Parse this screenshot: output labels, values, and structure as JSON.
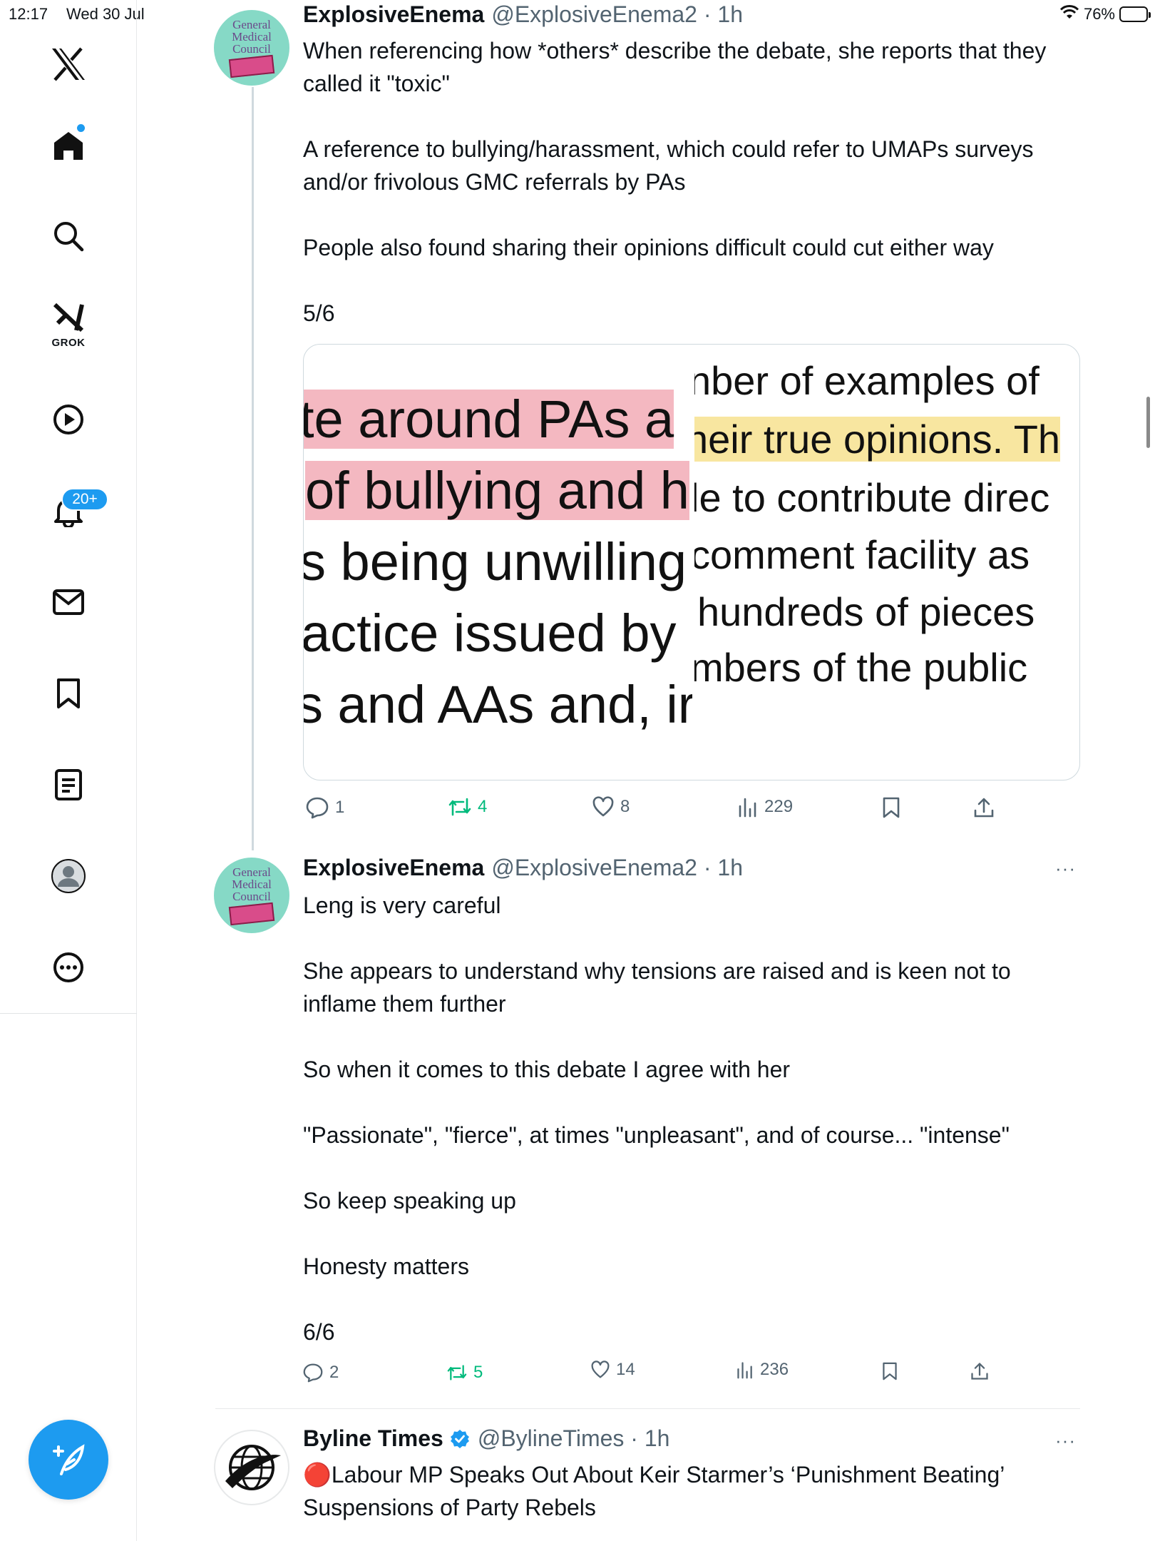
{
  "status_bar": {
    "time": "12:17",
    "date": "Wed 30 Jul",
    "battery": "76%",
    "battery_level": 0.76
  },
  "sidebar": {
    "items": [
      {
        "name": "x-logo"
      },
      {
        "name": "home",
        "has_dot": true
      },
      {
        "name": "search"
      },
      {
        "name": "grok",
        "label": "GROK"
      },
      {
        "name": "video"
      },
      {
        "name": "notifications",
        "badge": "20+"
      },
      {
        "name": "messages"
      },
      {
        "name": "bookmarks"
      },
      {
        "name": "lists"
      },
      {
        "name": "profile"
      },
      {
        "name": "more"
      }
    ]
  },
  "avatar_art": {
    "gmc_line1": "General",
    "gmc_line2": "Medical",
    "gmc_line3": "Council"
  },
  "tweets": [
    {
      "author": "ExplosiveEnema",
      "handle": "@ExplosiveEnema2 · 1h",
      "text": "When referencing how *others* describe the debate, she reports that they called it \"toxic\"\n\nA reference to bullying/harassment, which could refer to UMAPs surveys and/or frivolous GMC referrals by PAs\n\nPeople also found sharing their opinions difficult could cut either way\n\n5/6",
      "media": {
        "left_lines": [
          "te around PAs a",
          "of bullying and h",
          "s being unwilling",
          "actice issued by",
          "s and AAs and, ir"
        ],
        "right_lines": [
          "nber of examples of",
          "neir true opinions. Th",
          "le to contribute direc",
          "comment facility as",
          "hundreds of pieces",
          "mbers of the public"
        ]
      },
      "replies": "1",
      "reposts": "4",
      "likes": "8",
      "views": "229"
    },
    {
      "author": "ExplosiveEnema",
      "handle": "@ExplosiveEnema2 · 1h",
      "more": "···",
      "text": "Leng is very careful\n\nShe appears to understand why tensions are raised and is keen not to inflame them further\n\nSo when it comes to this debate I agree with her\n\n\"Passionate\", \"fierce\", at times \"unpleasant\", and of course... \"intense\"\n\nSo keep speaking up\n\nHonesty matters\n\n6/6",
      "replies": "2",
      "reposts": "5",
      "likes": "14",
      "views": "236"
    },
    {
      "author": "Byline Times",
      "verified": true,
      "handle": "@BylineTimes · 1h",
      "more": "···",
      "text": "🔴Labour MP Speaks Out About Keir Starmer’s ‘Punishment Beating’ Suspensions of Party Rebels"
    }
  ],
  "colors": {
    "accent": "#1d9bf0",
    "repost_green": "#00ba7c",
    "muted": "#536471",
    "border": "#cfd9de",
    "highlight_pink": "#f4b8c1",
    "highlight_yellow": "#f8e6a0"
  }
}
